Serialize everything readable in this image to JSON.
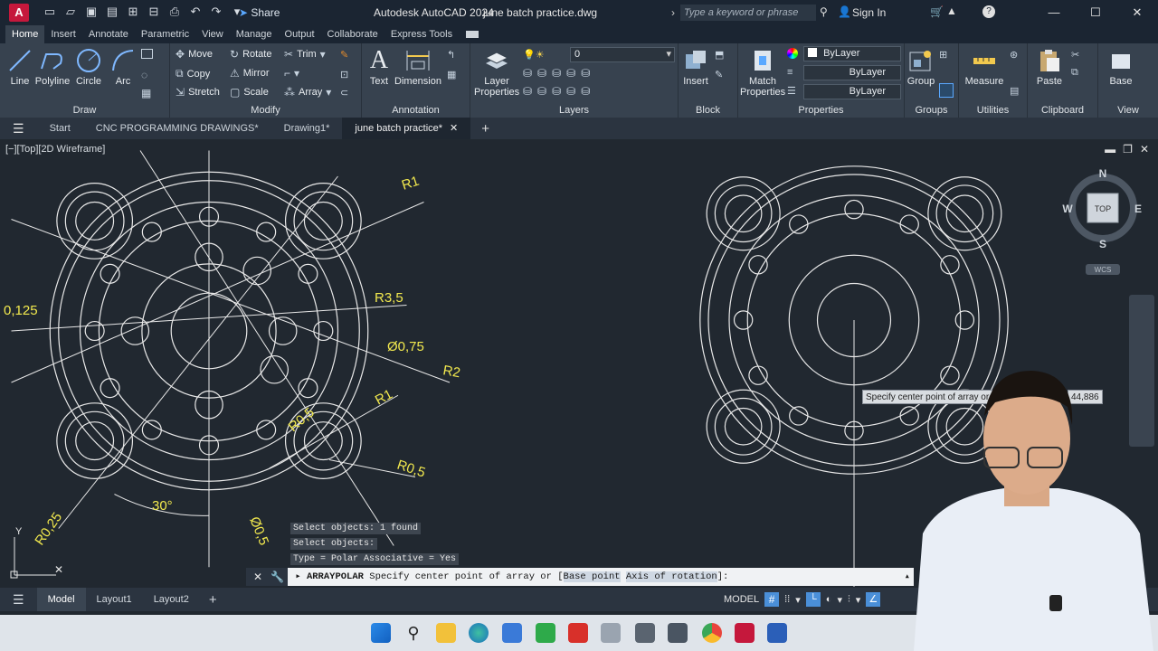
{
  "title_bar": {
    "app_logo": "A",
    "share_label": "Share",
    "app_title": "Autodesk AutoCAD 2024",
    "document_name": "june batch practice.dwg",
    "search_placeholder": "Type a keyword or phrase",
    "sign_in_label": "Sign In"
  },
  "ribbon_tabs": [
    "Home",
    "Insert",
    "Annotate",
    "Parametric",
    "View",
    "Manage",
    "Output",
    "Collaborate",
    "Express Tools"
  ],
  "active_ribbon_tab": "Home",
  "ribbon": {
    "draw": {
      "label": "Draw",
      "line": "Line",
      "polyline": "Polyline",
      "circle": "Circle",
      "arc": "Arc"
    },
    "modify": {
      "label": "Modify",
      "move": "Move",
      "rotate": "Rotate",
      "trim": "Trim",
      "copy": "Copy",
      "mirror": "Mirror",
      "stretch": "Stretch",
      "scale": "Scale",
      "array": "Array"
    },
    "annotation": {
      "label": "Annotation",
      "text": "Text",
      "dimension": "Dimension"
    },
    "layers": {
      "label": "Layers",
      "layer_properties_line1": "Layer",
      "layer_properties_line2": "Properties",
      "current_layer": "0"
    },
    "block": {
      "label": "Block",
      "insert": "Insert"
    },
    "properties": {
      "label": "Properties",
      "match_line1": "Match",
      "match_line2": "Properties",
      "color": "ByLayer",
      "linetype": "ByLayer",
      "lineweight": "ByLayer"
    },
    "groups": {
      "label": "Groups",
      "group": "Group"
    },
    "utilities": {
      "label": "Utilities",
      "measure": "Measure"
    },
    "clipboard": {
      "label": "Clipboard",
      "paste": "Paste"
    },
    "view": {
      "label": "View",
      "base": "Base"
    }
  },
  "file_tabs": [
    "Start",
    "CNC PROGRAMMING DRAWINGS*",
    "Drawing1*",
    "june batch practice*"
  ],
  "active_file_tab": "june batch practice*",
  "viewport_label": "[−][Top][2D Wireframe]",
  "dimensions": {
    "r1_top": "R1",
    "r3_5": "R3,5",
    "dia0_75": "Ø0,75",
    "r2": "R2",
    "r1_mid": "R1",
    "r0_5_a": "R0,5",
    "r0_5_b": "R0,5",
    "dia0_5": "Ø0,5",
    "angle30": "30°",
    "r0_25": "R0,25",
    "left_0_125": "0,125"
  },
  "viewcube": {
    "n": "N",
    "s": "S",
    "e": "E",
    "w": "W",
    "face": "TOP",
    "wcs": "WCS"
  },
  "command_history": [
    "Select objects: 1 found",
    "Select objects:",
    "Type = Polar  Associative = Yes"
  ],
  "command_line": {
    "command": "ARRAYPOLAR",
    "prompt": "Specify center point of array or [",
    "option1": "Base point",
    "option2": "Axis of rotation",
    "suffix": "]:"
  },
  "tooltip": {
    "text": "Specify center point of array or",
    "coord": "44,886"
  },
  "layout_tabs": [
    "Model",
    "Layout1",
    "Layout2"
  ],
  "active_layout_tab": "Model",
  "status": {
    "model_label": "MODEL"
  },
  "colors": {
    "canvas": "#212830",
    "ribbon": "#37424f",
    "dimension_yellow": "#f2e94e",
    "geometry_white": "#e8e8e8"
  }
}
